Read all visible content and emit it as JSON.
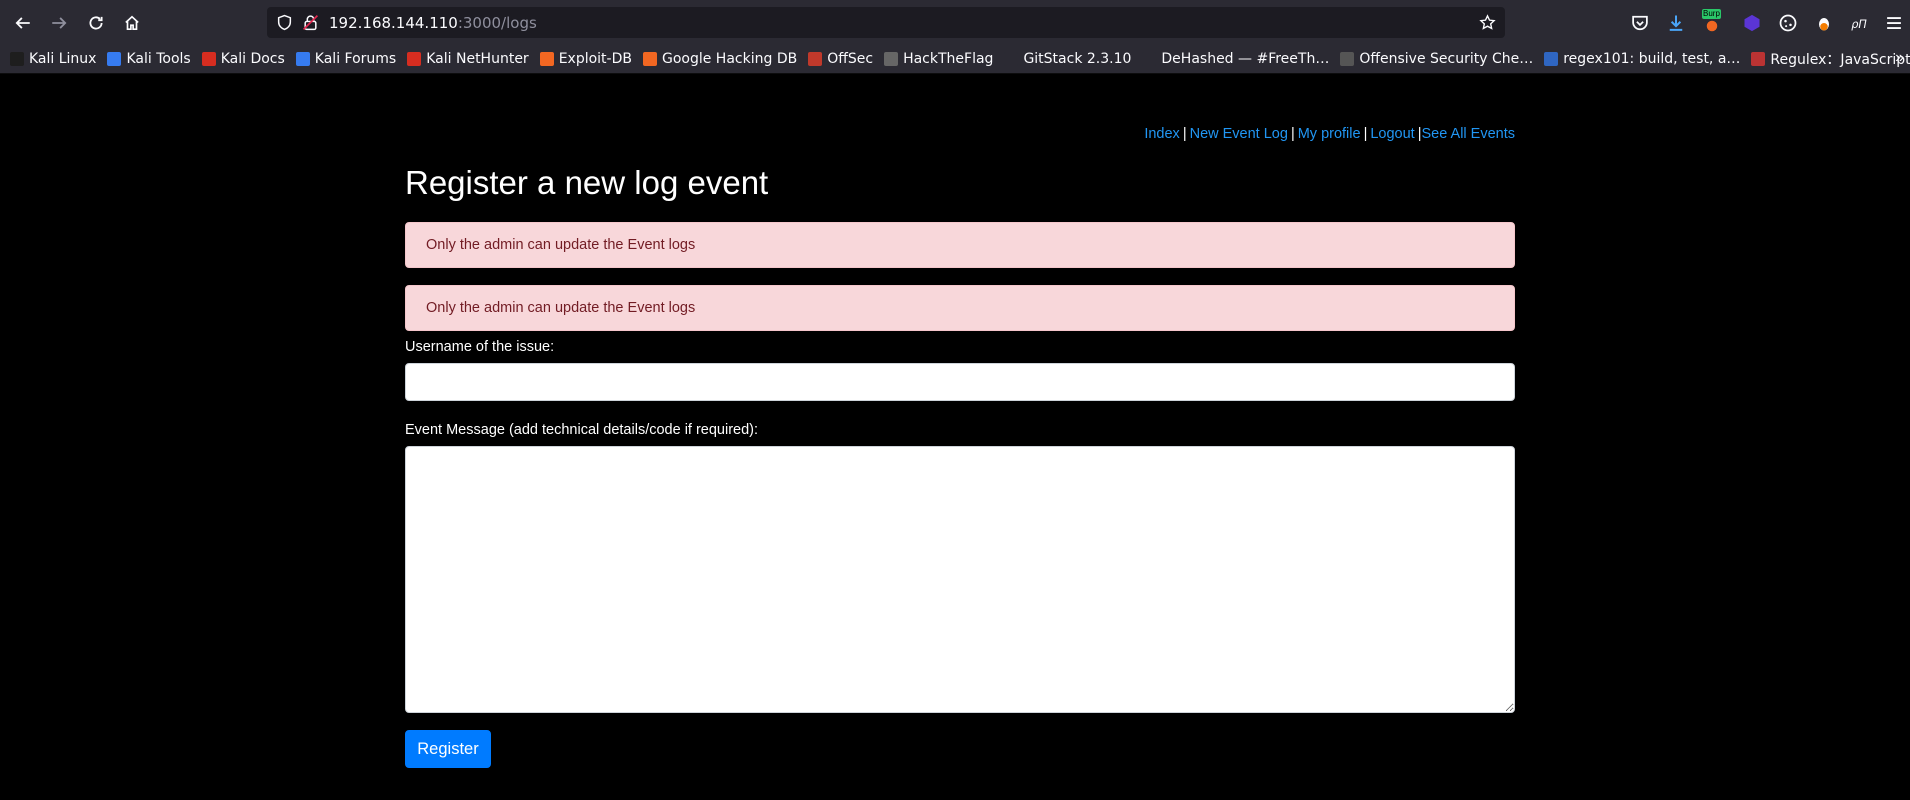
{
  "browser": {
    "url_host": "192.168.144.110",
    "url_path": ":3000/logs",
    "toolbar_icons": [
      "back-icon",
      "forward-icon",
      "reload-icon",
      "home-icon",
      "shield-icon",
      "lock-icon",
      "bookmark-star-icon",
      "pocket-icon",
      "download-icon",
      "burp-icon",
      "extension-icon",
      "cookie-icon",
      "extension-icon",
      "extension-icon",
      "menu-icon"
    ],
    "burp_badge": "Burp",
    "bookmarks": [
      {
        "label": "Kali Linux",
        "color": "#1e1e1e"
      },
      {
        "label": "Kali Tools",
        "color": "#367bf0"
      },
      {
        "label": "Kali Docs",
        "color": "#d62d20"
      },
      {
        "label": "Kali Forums",
        "color": "#367bf0"
      },
      {
        "label": "Kali NetHunter",
        "color": "#d62d20"
      },
      {
        "label": "Exploit-DB",
        "color": "#f26722"
      },
      {
        "label": "Google Hacking DB",
        "color": "#f26722"
      },
      {
        "label": "OffSec",
        "color": "#c0392b"
      },
      {
        "label": "HackTheFlag",
        "color": "#666666"
      },
      {
        "label": "GitStack 2.3.10",
        "color": "#2b2a33"
      },
      {
        "label": "DeHashed — #FreeTh…",
        "color": "#2b2a33"
      },
      {
        "label": "Offensive Security Che…",
        "color": "#555555"
      },
      {
        "label": "regex101: build, test, a…",
        "color": "#2f66c2"
      },
      {
        "label": "Regulex：JavaScript R…",
        "color": "#b33"
      }
    ],
    "overflow_symbol": "»"
  },
  "nav": {
    "index": "Index",
    "new_event_log": "New Event Log",
    "my_profile": "My profile",
    "logout": "Logout",
    "see_all_events": "See All Events",
    "separator": "|"
  },
  "page": {
    "title": "Register a new log event",
    "alerts": [
      "Only the admin can update the Event logs",
      "Only the admin can update the Event logs"
    ],
    "username_label": "Username of the issue:",
    "username_value": "",
    "message_label": "Event Message (add technical details/code if required):",
    "message_value": "",
    "register_button": "Register"
  },
  "colors": {
    "link": "#2196f3",
    "alert_bg": "#f8d7da",
    "alert_text": "#721c24",
    "button": "#007bff",
    "chrome": "#2b2a33"
  }
}
